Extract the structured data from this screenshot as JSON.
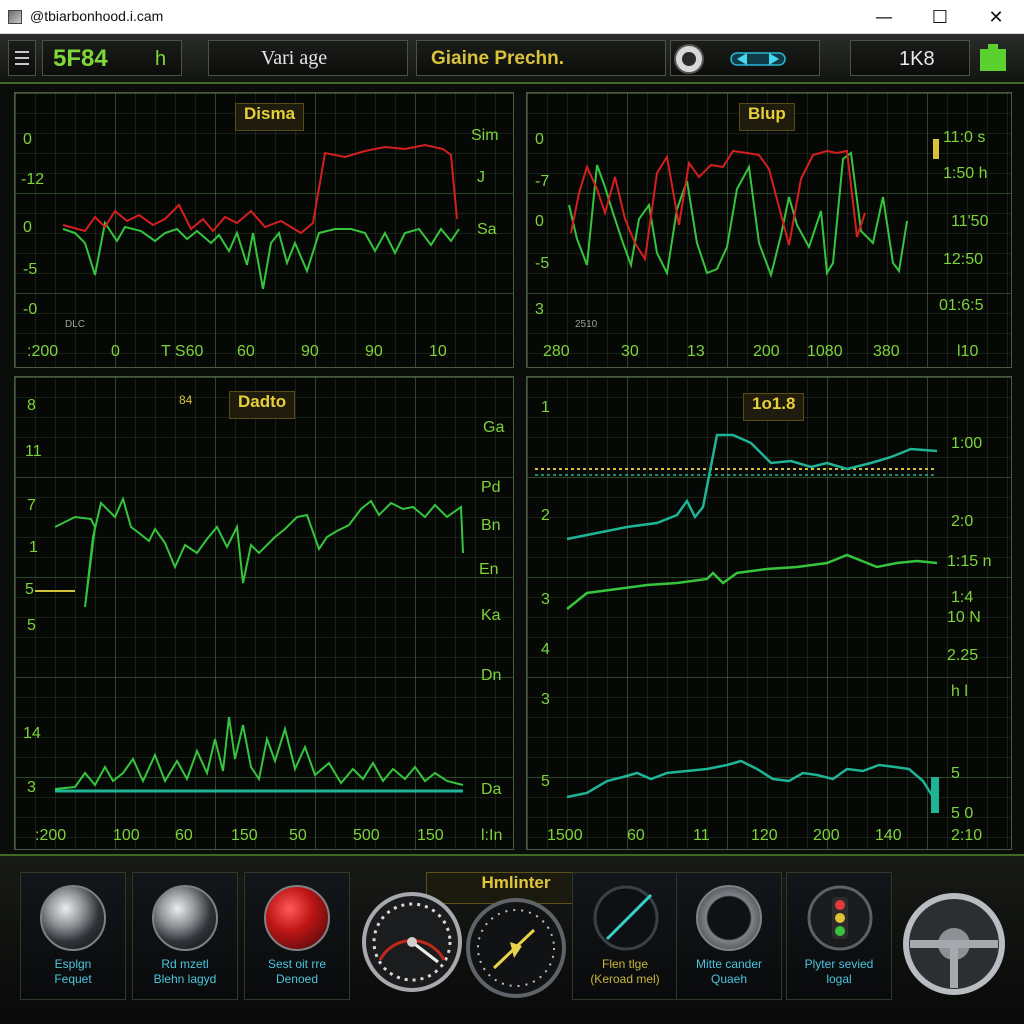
{
  "window": {
    "title": "@tbiarbonhood.i.cam",
    "minimize": "—",
    "maximize": "☐",
    "close": "✕"
  },
  "toolbar": {
    "left_code": "5F84",
    "left_glyph": "h",
    "var_label": "Vari age",
    "title": "Giaine Prechn.",
    "right_code": "1K8"
  },
  "panels": {
    "top_left": {
      "title": "Disma",
      "y_left": [
        "0",
        "-12",
        "0",
        "-5",
        "-0"
      ],
      "y_right": [
        "Sim",
        "J",
        "Sa"
      ],
      "x": [
        ":200",
        "0",
        "T S60",
        "60",
        "90",
        "90",
        "10"
      ],
      "legend": "DLC"
    },
    "top_right": {
      "title": "Blup",
      "y_left": [
        "0",
        "-7",
        "0",
        "-5",
        "3"
      ],
      "y_right": [
        "11:0 s",
        "1:50 h",
        "11'50",
        "12:50",
        "01:6:5"
      ],
      "x": [
        "280",
        "30",
        "13",
        "200",
        "1080",
        "380",
        "l10"
      ],
      "legend": "2510"
    },
    "bottom_left": {
      "title": "Dadto",
      "small_mark": "84",
      "y_left": [
        "8",
        "11",
        "7",
        "1",
        "5",
        "5",
        "14",
        "3"
      ],
      "y_right": [
        "Ga",
        "Pd",
        "Bn",
        "En",
        "Ka",
        "Dn",
        "Da"
      ],
      "x": [
        ":200",
        "100",
        "60",
        "150",
        "50",
        "500",
        "150",
        "l:In"
      ]
    },
    "bottom_right": {
      "title": "1o1.8",
      "y_left": [
        "1",
        "2",
        "3",
        "4",
        "3",
        "5"
      ],
      "y_right": [
        "1:00",
        "2:0",
        "1:15 n",
        "1:4",
        "10 N",
        "2.25",
        "h l",
        "5",
        "5 0"
      ],
      "x": [
        "1500",
        "60",
        "11",
        "120",
        "200",
        "140",
        "2:10"
      ]
    }
  },
  "footer": {
    "center_label": "Hmlinter",
    "gauges": [
      {
        "name": "dial-white-1",
        "line1": "Esplgn",
        "line2": "Fequet",
        "accent": "#e8e8e8"
      },
      {
        "name": "dial-white-2",
        "line1": "Rd mzetl",
        "line2": "Blehn lagyd",
        "accent": "#f1f1f1"
      },
      {
        "name": "dial-red",
        "line1": "Sest oit rre",
        "line2": "Denoed",
        "accent": "#d61f1f"
      },
      {
        "name": "dial-large-1",
        "line1": "",
        "line2": "",
        "accent": "#cfcfcf"
      },
      {
        "name": "dial-large-2",
        "line1": "",
        "line2": "",
        "accent": "#dfd04a"
      },
      {
        "name": "dial-needle",
        "line1": "Flen tlge",
        "line2": "(Keroad mel)",
        "accent": "#39d0c7"
      },
      {
        "name": "dial-mute",
        "line1": "Mitte cander",
        "line2": "Quaeh",
        "accent": "#d8d8d8"
      },
      {
        "name": "dial-traffic",
        "line1": "Plyter sevied",
        "line2": "logal",
        "accent": "#e33939"
      },
      {
        "name": "dial-wheel",
        "line1": "",
        "line2": "",
        "accent": "#d4d4d4"
      }
    ]
  },
  "colors": {
    "green_trace": "#36c43d",
    "red_trace": "#d51f1f",
    "teal_trace": "#1fb496",
    "label_green": "#7ed33b",
    "title_yellow": "#e6cf39"
  }
}
